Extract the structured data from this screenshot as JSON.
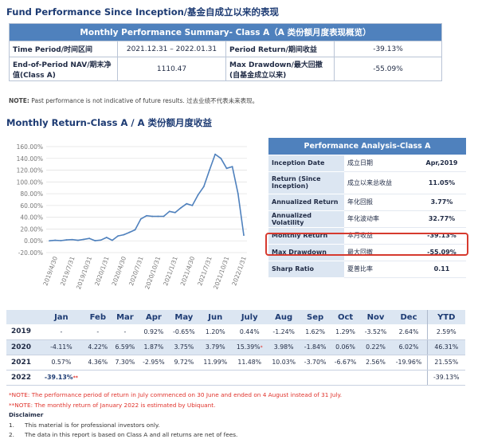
{
  "page": {
    "title": "Fund Performance Since Inception/基金自成立以来的表现",
    "chart_heading": "Monthly Return-Class A / A 类份额月度收益"
  },
  "summary": {
    "heading": "Monthly Performance Summary- Class A（A 类份额月度表现概览）",
    "rows": [
      {
        "label1": "Time Period/时间区间",
        "value1": "2021.12.31 – 2022.01.31",
        "label2": "Period Return/期间收益",
        "value2": "-39.13%"
      },
      {
        "label1": "End-of-Period NAV/期末净值(Class A)",
        "value1": "1110.47",
        "label2": "Max Drawdown/最大回撤(自基金成立以来)",
        "value2": "-55.09%"
      }
    ],
    "note_bold": "NOTE:",
    "note_text": "Past performance is not indicative of future results.  过去业绩不代表未来表现。"
  },
  "chart_data": {
    "type": "line",
    "title": "",
    "xlabel": "",
    "ylabel": "",
    "ylim": [
      -20,
      160
    ],
    "yticks": [
      "160.00%",
      "140.00%",
      "120.00%",
      "100.00%",
      "80.00%",
      "60.00%",
      "40.00%",
      "20.00%",
      "0.00%",
      "-20.00%"
    ],
    "xticks": [
      "2019/4/30",
      "2019/7/31",
      "2019/10/31",
      "2020/1/31",
      "2020/4/30",
      "2020/7/31",
      "2020/10/31",
      "2021/1/31",
      "2021/4/30",
      "2021/7/31",
      "2021/10/31",
      "2022/1/31"
    ],
    "line_color": "#4f81bd",
    "x": [
      "2019/3/31",
      "2019/4/30",
      "2019/5/31",
      "2019/6/30",
      "2019/7/31",
      "2019/8/31",
      "2019/9/30",
      "2019/10/31",
      "2019/11/30",
      "2019/12/31",
      "2020/1/31",
      "2020/2/29",
      "2020/3/31",
      "2020/4/30",
      "2020/5/31",
      "2020/6/30",
      "2020/7/31",
      "2020/8/31",
      "2020/9/30",
      "2020/10/31",
      "2020/11/30",
      "2020/12/31",
      "2021/1/31",
      "2021/2/28",
      "2021/3/31",
      "2021/4/30",
      "2021/5/31",
      "2021/6/30",
      "2021/7/31",
      "2021/8/31",
      "2021/9/30",
      "2021/10/31",
      "2021/11/30",
      "2021/12/31",
      "2022/1/31"
    ],
    "values": [
      0,
      0.9,
      0.3,
      1.5,
      2.0,
      0.8,
      2.4,
      4.1,
      0.2,
      1.3,
      5.7,
      0.9,
      8.3,
      10.3,
      14.4,
      18.7,
      37.1,
      42.6,
      41.6,
      41.6,
      41.6,
      50.0,
      48.0,
      56.0,
      63.0,
      60.0,
      78.0,
      92.0,
      120.0,
      147.0,
      140.0,
      123.0,
      126.0,
      80.0,
      9.5
    ]
  },
  "perf": {
    "heading": "Performance Analysis-Class A",
    "rows": [
      {
        "en": "Inception Date",
        "cn": "成立日期",
        "val": "Apr,2019"
      },
      {
        "en": "Return (Since Inception)",
        "cn": "成立以来总收益",
        "val": "11.05%"
      },
      {
        "en": "Annualized Return",
        "cn": "年化回报",
        "val": "3.77%"
      },
      {
        "en": "Annualized Volatility",
        "cn": "年化波动率",
        "val": "32.77%"
      },
      {
        "en": "Monthly Return",
        "cn": "本月收益",
        "val": "-39.13%"
      },
      {
        "en": "Max Drawdown",
        "cn": "最大回撤",
        "val": "-55.09%"
      },
      {
        "en": "Sharp Ratio",
        "cn": "夏普比率",
        "val": "0.11"
      }
    ]
  },
  "returns": {
    "months": [
      "Jan",
      "Feb",
      "Mar",
      "Apr",
      "May",
      "Jun",
      "July",
      "Aug",
      "Sep",
      "Oct",
      "Nov",
      "Dec",
      "YTD"
    ],
    "rows": [
      {
        "year": "2019",
        "values": [
          "-",
          "-",
          "-",
          "0.92%",
          "-0.65%",
          "1.20%",
          "0.44%",
          "-1.24%",
          "1.62%",
          "1.29%",
          "-3.52%",
          "2.64%",
          "2.59%"
        ]
      },
      {
        "year": "2020",
        "values": [
          "-4.11%",
          "4.22%",
          "6.59%",
          "1.87%",
          "3.75%",
          "3.79%",
          "15.39%",
          "3.98%",
          "-1.84%",
          "0.06%",
          "0.22%",
          "6.02%",
          "46.31%"
        ]
      },
      {
        "year": "2021",
        "values": [
          "0.57%",
          "4.36%",
          "7.30%",
          "-2.95%",
          "9.72%",
          "11.99%",
          "11.48%",
          "10.03%",
          "-3.70%",
          "-6.67%",
          "2.56%",
          "-19.96%",
          "21.55%"
        ]
      },
      {
        "year": "2022",
        "values": [
          "-39.13%",
          "",
          "",
          "",
          "",
          "",
          "",
          "",
          "",
          "",
          "",
          "",
          "-39.13%"
        ]
      }
    ],
    "star_single": "*",
    "star_double": "**"
  },
  "notes": {
    "n1": "*NOTE: The performance period of return in July commenced on 30 June and ended on 4 August instead of 31 July.",
    "n2": "**NOTE: The monthly return of January 2022 is estimated by Ubiquant.",
    "disclaimer": "Disclaimer",
    "d1_num": "1.",
    "d1": "This material is for professional investors only.",
    "d2_num": "2.",
    "d2": "The data in this report is based on Class A and all returns are net of fees."
  }
}
